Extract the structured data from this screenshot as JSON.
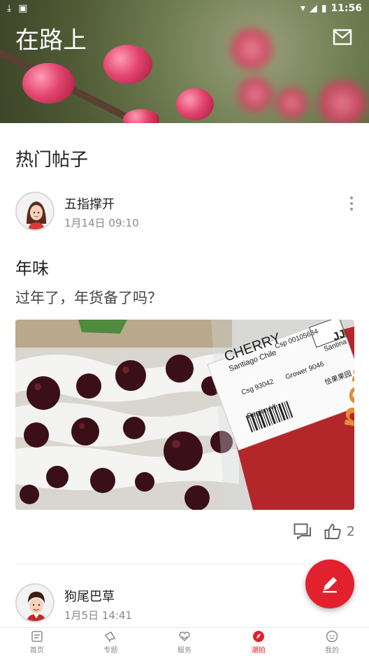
{
  "status_bar": {
    "time": "11:56"
  },
  "header": {
    "title": "在路上"
  },
  "section": {
    "title": "热门帖子"
  },
  "posts": [
    {
      "author": "五指撑开",
      "date": "1月14日 09:10",
      "title": "年味",
      "body": "过年了，年货备了吗？",
      "likes": "2",
      "photo_label": {
        "line1": "CHERRY",
        "line2": "Santiago Chile",
        "line3": "Csp 00105634",
        "line4": "Csg 93042",
        "line5": "Grower 9046",
        "line6": "Region VI",
        "brand_top": "JJ",
        "brand_side": "Santina",
        "chinese": "恰果果园",
        "box_text": "ner"
      }
    },
    {
      "author": "狗尾巴草",
      "date": "1月5日 14:41"
    }
  ],
  "bottom_nav": [
    {
      "label": "首页",
      "icon": "home-icon",
      "active": false
    },
    {
      "label": "专题",
      "icon": "megaphone-icon",
      "active": false
    },
    {
      "label": "服务",
      "icon": "heart-hands-icon",
      "active": false
    },
    {
      "label": "潮拍",
      "icon": "compass-leaf-icon",
      "active": true
    },
    {
      "label": "我的",
      "icon": "smile-icon",
      "active": false
    }
  ],
  "colors": {
    "accent": "#e3202d",
    "muted": "#8a8a8a"
  }
}
